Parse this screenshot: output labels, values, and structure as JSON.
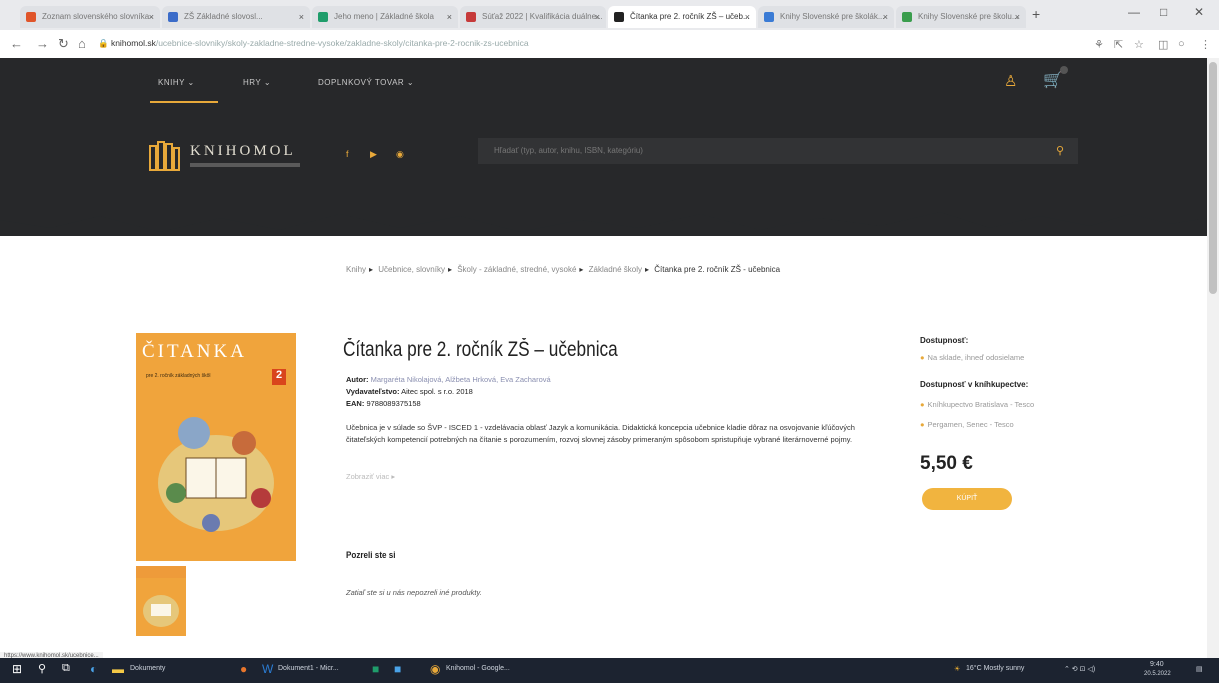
{
  "browser": {
    "tabs": [
      {
        "label": "Zoznam slovenského slovníka",
        "favicon": "#e0552a"
      },
      {
        "label": "ZŠ Základné slovosl...",
        "favicon": "#3b6cc9"
      },
      {
        "label": "Jeho meno | Základné škola",
        "favicon": "#1f9d6b"
      },
      {
        "label": "Súťaž 2022 | Kvalifikácia duálne...",
        "favicon": "#c63a3a"
      },
      {
        "label": "Čítanka pre 2. ročník ZŠ – učeb...",
        "favicon": "#222222"
      },
      {
        "label": "Knihy Slovenské pre školák...",
        "favicon": "#3a7bd5"
      },
      {
        "label": "Knihy Slovenské pre školu...",
        "favicon": "#3a9d4d"
      }
    ],
    "url_domain": "knihomol.sk",
    "url_path": "/ucebnice-slovniky/skoly-zakladne-stredne-vysoke/zakladne-skoly/citanka-pre-2-rocnik-zs-ucebnica"
  },
  "site": {
    "nav": [
      "KNIHY",
      "HRY",
      "DOPLNKOVÝ TOVAR"
    ],
    "logo_text": "KNIHOMOL",
    "search_placeholder": "Hľadať (typ, autor, knihu, ISBN, kategóriu)",
    "accent": "#e8a93a",
    "header_bg": "#27282a"
  },
  "breadcrumb": {
    "items": [
      "Knihy",
      "Učebnice, slovníky",
      "Školy - základné, stredné, vysoké",
      "Základné školy"
    ],
    "current": "Čítanka pre 2. ročník ZŠ - učebnica"
  },
  "product": {
    "cover_title": "ČITANKA",
    "cover_sub": "pre 2. ročník základných škôl",
    "cover_num": "2",
    "title": "Čítanka pre 2. ročník ZŠ – učebnica",
    "author_label": "Autor:",
    "authors": "Margaréta Nikolajová, Alžbeta Hrková, Eva Zacharová",
    "publisher_label": "Vydavateľstvo:",
    "publisher": "Aitec spol. s r.o. 2018",
    "ean_label": "EAN:",
    "ean": "9788089375158",
    "description": "Učebnica je v súlade so ŠVP - ISCED 1 - vzdelávacia oblasť Jazyk a komunikácia. Didaktická koncepcia učebnice kladie dôraz na osvojovanie kľúčových čitateľských kompetencií potrebných na čítanie s porozumením, rozvoj slovnej zásoby primeraným spôsobom spristupňuje vybrané literárnoverné pojmy.",
    "more": "Zobraziť viac",
    "viewed_title": "Pozreli ste si",
    "viewed_text": "Zatiaľ ste si u nás nepozreli iné produkty."
  },
  "sidebar": {
    "availability_label": "Dostupnosť:",
    "availability_value": "Na sklade, ihneď odosielame",
    "stores_label": "Dostupnosť v kníhkupectve:",
    "stores": [
      "Kníhkupectvo Bratislava - Tesco",
      "Pergamen, Senec - Tesco"
    ],
    "price": "5,50 €",
    "buy_label": "KÚPIŤ"
  },
  "status_url": "https://www.knihomol.sk/ucebnice...",
  "taskbar": {
    "apps": [
      "Dokumenty",
      "Dokument1 - Micr...",
      "Knihomol - Google..."
    ],
    "weather": "16°C Mostly sunny",
    "time": "9:40",
    "date": "20.5.2022"
  }
}
